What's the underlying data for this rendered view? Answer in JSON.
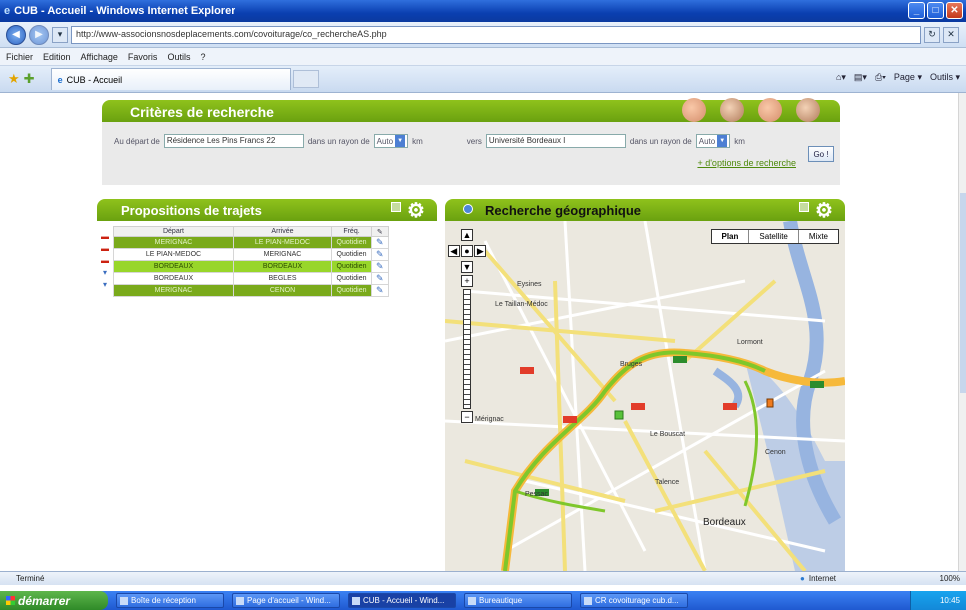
{
  "window": {
    "title": "CUB - Accueil - Windows Internet Explorer"
  },
  "address": {
    "url": "http://www-associonsnosdeplacements.com/covoiturage/co_rechercheAS.php"
  },
  "menu": [
    "Fichier",
    "Edition",
    "Affichage",
    "Favoris",
    "Outils",
    "?"
  ],
  "tab": {
    "label": "CUB - Accueil"
  },
  "commands": [
    "Page ▾",
    "Outils ▾"
  ],
  "criteria": {
    "title": "Critères de recherche",
    "from_label": "Au départ de",
    "from_value": "Résidence Les Pins Francs 22",
    "radius_label": "dans un rayon de",
    "radius_value": "Auto",
    "km": "km",
    "to_label": "vers",
    "to_value": "Université Bordeaux I",
    "more_link": "+ d'options de recherche",
    "go_label": "Go !"
  },
  "propositions": {
    "title": "Propositions de trajets",
    "columns": [
      "Départ",
      "Arrivée",
      "Fréq."
    ],
    "rows": [
      {
        "from": "MERIGNAC",
        "to": "LE PIAN-MEDOC",
        "freq": "Quotidien",
        "style": "g"
      },
      {
        "from": "LE PIAN-MEDOC",
        "to": "MERIGNAC",
        "freq": "Quotidien",
        "style": "w"
      },
      {
        "from": "BORDEAUX",
        "to": "BORDEAUX",
        "freq": "Quotidien",
        "style": "bright"
      },
      {
        "from": "BORDEAUX",
        "to": "BEGLES",
        "freq": "Quotidien",
        "style": "w"
      },
      {
        "from": "MERIGNAC",
        "to": "CENON",
        "freq": "Quotidien",
        "style": "g"
      }
    ]
  },
  "map": {
    "title": "Recherche géographique",
    "types": [
      "Plan",
      "Satellite",
      "Mixte"
    ],
    "labels": [
      "Le Taillan-Médoc",
      "Bordeaux",
      "Bruges",
      "Mérignac",
      "Le Bouscat",
      "Eysines",
      "Cenon",
      "Lormont",
      "Pessac",
      "Talence"
    ]
  },
  "status": {
    "text": "Terminé",
    "zone": "Internet",
    "zoom": "100%"
  },
  "taskbar": {
    "start": "démarrer",
    "items": [
      "Boîte de réception",
      "Page d'accueil - Wind...",
      "CUB - Accueil - Wind...",
      "Bureautique",
      "CR covoiturage cub.d..."
    ],
    "clock": "10:45"
  }
}
